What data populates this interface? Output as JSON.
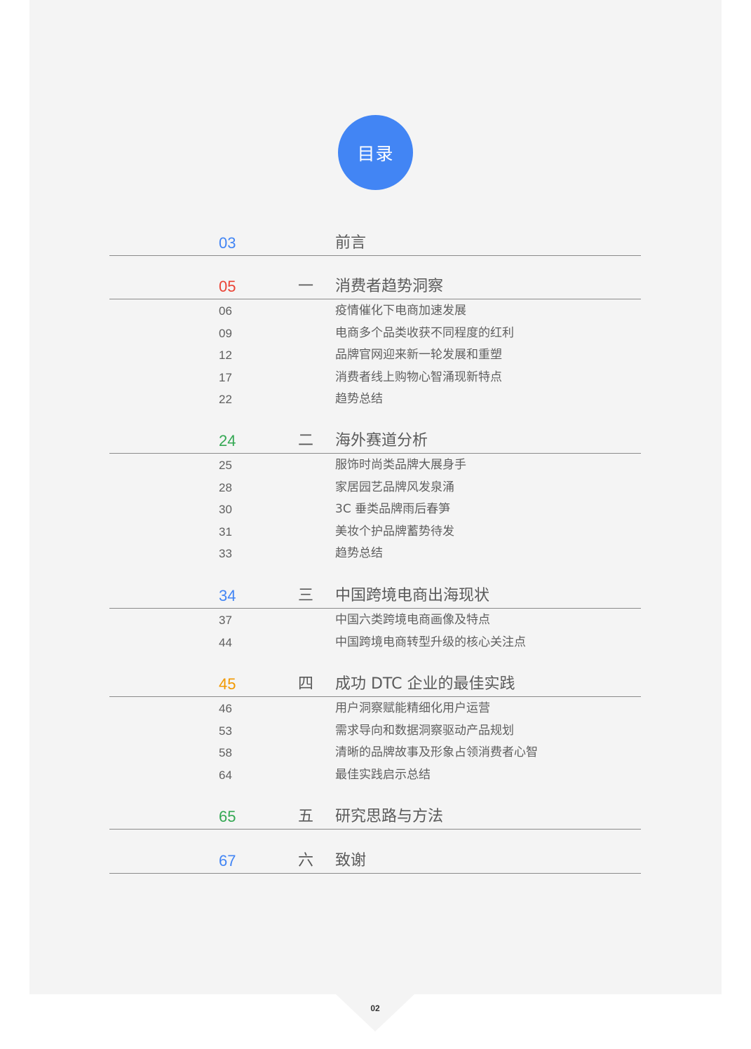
{
  "header": {
    "title": "目录",
    "accent_color": "#4285f4"
  },
  "toc": {
    "sections": [
      {
        "page": "03",
        "numeral": "",
        "title": "前言",
        "color": "#4285f4",
        "items": []
      },
      {
        "page": "05",
        "numeral": "一",
        "title": "消费者趋势洞察",
        "color": "#ea4335",
        "items": [
          {
            "page": "06",
            "title": "疫情催化下电商加速发展"
          },
          {
            "page": "09",
            "title": "电商多个品类收获不同程度的红利"
          },
          {
            "page": "12",
            "title": "品牌官网迎来新一轮发展和重塑"
          },
          {
            "page": "17",
            "title": "消费者线上购物心智涌现新特点"
          },
          {
            "page": "22",
            "title": "趋势总结"
          }
        ]
      },
      {
        "page": "24",
        "numeral": "二",
        "title": "海外赛道分析",
        "color": "#34a853",
        "items": [
          {
            "page": "25",
            "title": "服饰时尚类品牌大展身手"
          },
          {
            "page": "28",
            "title": "家居园艺品牌风发泉涌"
          },
          {
            "page": "30",
            "title": "3C 垂类品牌雨后春笋"
          },
          {
            "page": "31",
            "title": "美妆个护品牌蓄势待发"
          },
          {
            "page": "33",
            "title": "趋势总结"
          }
        ]
      },
      {
        "page": "34",
        "numeral": "三",
        "title": "中国跨境电商出海现状",
        "color": "#4285f4",
        "items": [
          {
            "page": "37",
            "title": "中国六类跨境电商画像及特点"
          },
          {
            "page": "44",
            "title": "中国跨境电商转型升级的核心关注点"
          }
        ]
      },
      {
        "page": "45",
        "numeral": "四",
        "title": "成功 DTC 企业的最佳实践",
        "color": "#f29900",
        "items": [
          {
            "page": "46",
            "title": "用户洞察赋能精细化用户运营"
          },
          {
            "page": "53",
            "title": "需求导向和数据洞察驱动产品规划"
          },
          {
            "page": "58",
            "title": "清晰的品牌故事及形象占领消费者心智"
          },
          {
            "page": "64",
            "title": "最佳实践启示总结"
          }
        ]
      },
      {
        "page": "65",
        "numeral": "五",
        "title": "研究思路与方法",
        "color": "#34a853",
        "items": []
      },
      {
        "page": "67",
        "numeral": "六",
        "title": "致谢",
        "color": "#4285f4",
        "items": []
      }
    ]
  },
  "footer": {
    "page_number": "02"
  }
}
